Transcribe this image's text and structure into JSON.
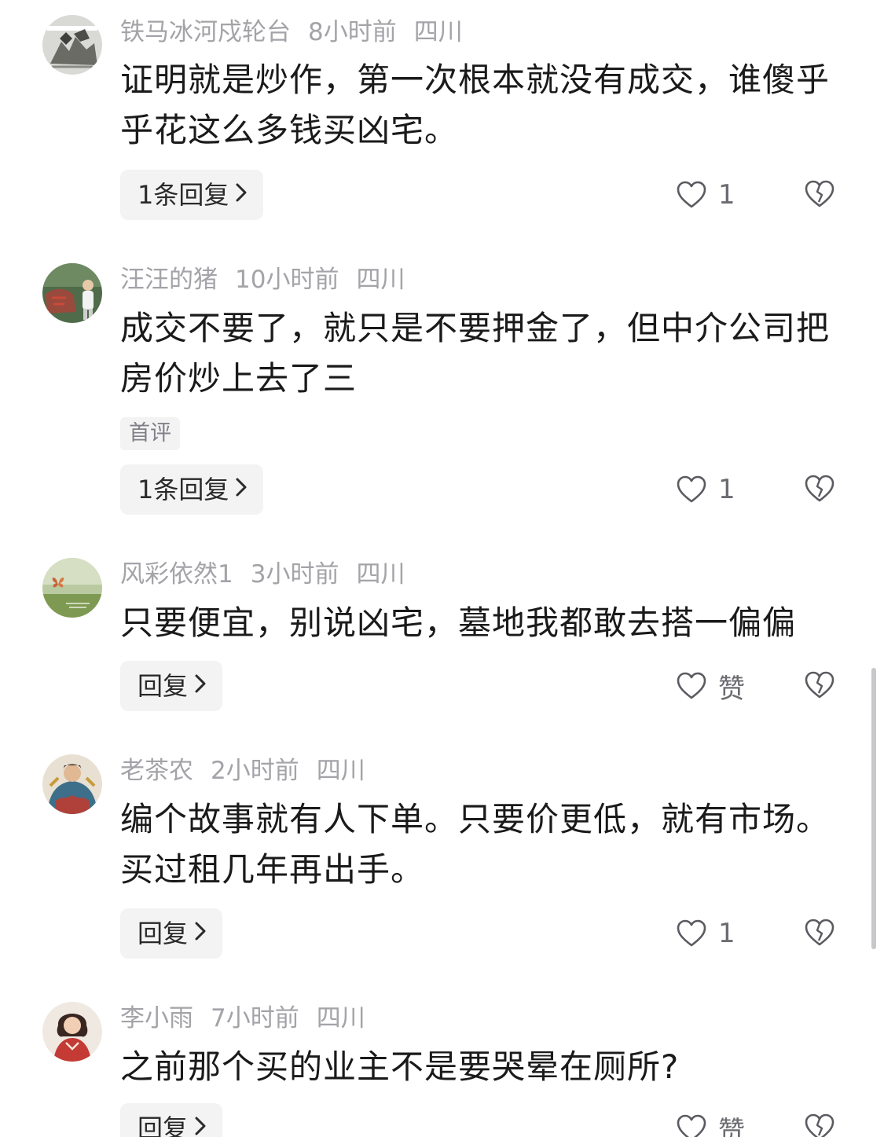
{
  "comments": [
    {
      "username": "铁马冰河戍轮台",
      "time": "8小时前",
      "location": "四川",
      "text": "证明就是炒作，第一次根本就没有成交，谁傻乎乎花这么多钱买凶宅。",
      "tag": "",
      "reply_label": "1条回复",
      "like_count": "1",
      "avatar": "avatar-warrior-sketch"
    },
    {
      "username": "汪汪的猪",
      "time": "10小时前",
      "location": "四川",
      "text": "成交不要了，就只是不要押金了，但中介公司把房价炒上去了三",
      "tag": "首评",
      "reply_label": "1条回复",
      "like_count": "1",
      "avatar": "avatar-person-with-rock"
    },
    {
      "username": "风彩依然1",
      "time": "3小时前",
      "location": "四川",
      "text": "只要便宜，别说凶宅，墓地我都敢去搭一偏偏",
      "tag": "",
      "reply_label": "回复",
      "like_count": "赞",
      "avatar": "avatar-butterfly-meadow"
    },
    {
      "username": "老茶农",
      "time": "2小时前",
      "location": "四川",
      "text": "编个故事就有人下单。只要价更低，就有市场。买过租几年再出手。",
      "tag": "",
      "reply_label": "回复",
      "like_count": "1",
      "avatar": "avatar-colorful-figure"
    },
    {
      "username": "李小雨",
      "time": "7小时前",
      "location": "四川",
      "text": "之前那个买的业主不是要哭晕在厕所?",
      "tag": "",
      "reply_label": "回复",
      "like_count": "赞",
      "avatar": "avatar-girl-red-dress"
    }
  ],
  "icons": {
    "like": "heart-outline-icon",
    "dislike": "broken-heart-icon",
    "reply_chevron": "chevron-right-icon"
  },
  "colors": {
    "meta": "#a3a3a8",
    "text": "#1a1a1a",
    "pill_bg": "#f3f3f4"
  }
}
